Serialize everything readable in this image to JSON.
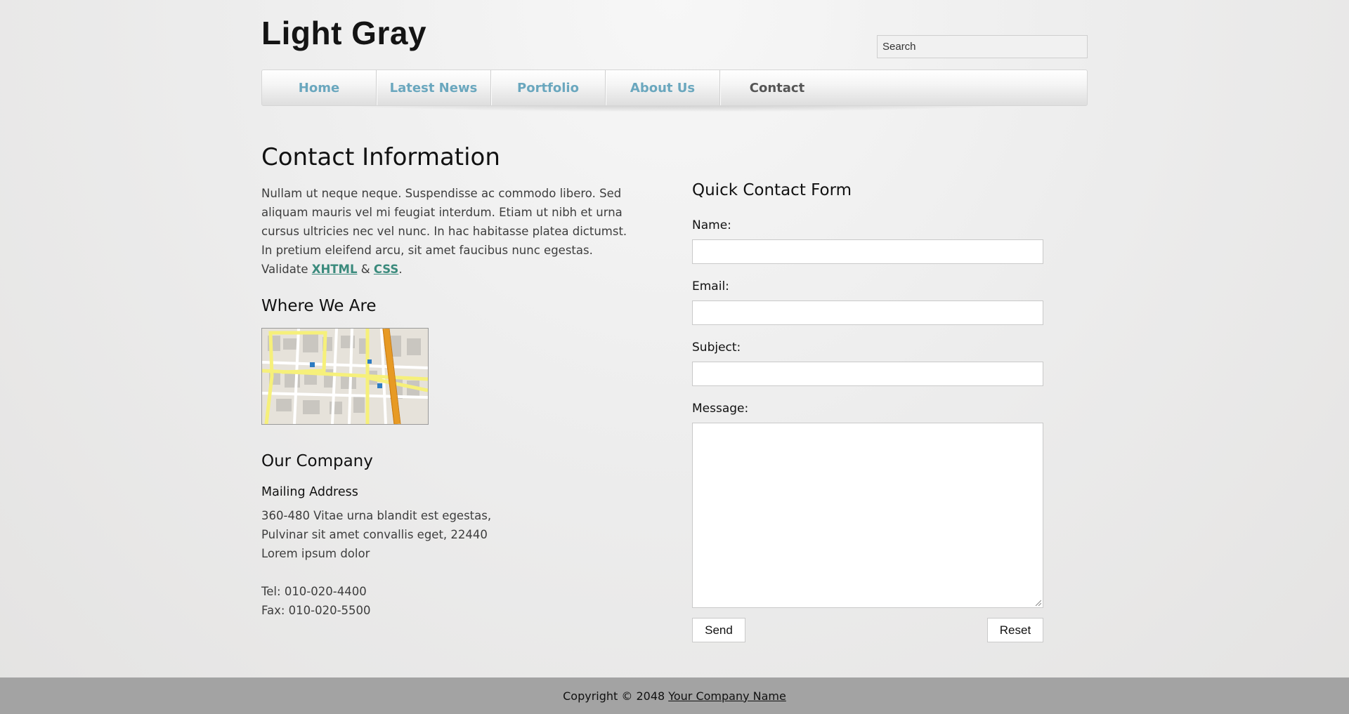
{
  "header": {
    "logo_text": "Light Gray",
    "search_value": "Search"
  },
  "nav": {
    "items": [
      {
        "label": "Home"
      },
      {
        "label": "Latest News"
      },
      {
        "label": "Portfolio"
      },
      {
        "label": "About Us"
      },
      {
        "label": "Contact"
      }
    ],
    "active": "Contact"
  },
  "content": {
    "title": "Contact Information",
    "intro_text": "Nullam ut neque neque. Suspendisse ac commodo libero. Sed aliquam mauris vel mi feugiat interdum. Etiam ut nibh et urna cursus ultricies nec vel nunc. In hac habitasse platea dictumst. In pretium eleifend arcu, sit amet faucibus nunc egestas. Validate",
    "link_xhtml": "XHTML",
    "ampersand": "&",
    "link_css": "CSS",
    "period": ".",
    "where_title": "Where We Are",
    "company_title": "Our Company",
    "mailing_title": "Mailing Address",
    "address_lines": [
      "360-480 Vitae urna blandit est egestas,",
      "Pulvinar sit amet convallis eget, 22440",
      "Lorem ipsum dolor"
    ],
    "tel": "Tel: 010-020-4400",
    "fax": "Fax: 010-020-5500"
  },
  "form": {
    "title": "Quick Contact Form",
    "name_label": "Name:",
    "email_label": "Email:",
    "subject_label": "Subject:",
    "message_label": "Message:",
    "send_label": "Send",
    "reset_label": "Reset"
  },
  "footer": {
    "copyright": "Copyright © 2048",
    "company_link": "Your Company Name"
  },
  "colors": {
    "nav_link": "#6aa7be",
    "nav_active": "#555555",
    "text_link": "#3a8a7c",
    "footer_bg": "#a3a3a3"
  }
}
